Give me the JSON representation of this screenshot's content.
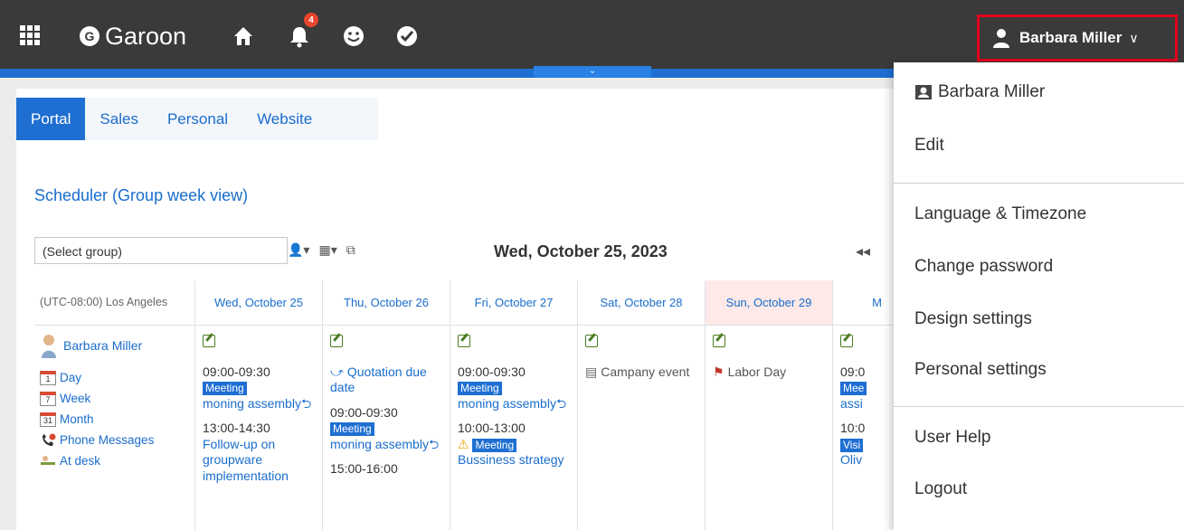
{
  "header": {
    "app_name": "Garoon",
    "logo_letter": "G",
    "notification_count": "4",
    "icons": [
      "app-grid-icon",
      "home-icon",
      "bell-icon",
      "smile-icon",
      "check-icon"
    ],
    "user_name": "Barbara Miller",
    "user_chevron": "∨",
    "collapse_glyph": "⌄"
  },
  "tabs": [
    {
      "label": "Portal",
      "active": true
    },
    {
      "label": "Sales",
      "active": false
    },
    {
      "label": "Personal",
      "active": false
    },
    {
      "label": "Website",
      "active": false
    }
  ],
  "scheduler": {
    "title": "Scheduler (Group week view)",
    "group_select": "(Select group)",
    "date": "Wed, October 25, 2023",
    "prev_glyph": "◂◂",
    "timezone_label": "(UTC-08:00) Los Angeles",
    "columns": [
      "Wed, October 25",
      "Thu, October 26",
      "Fri, October 27",
      "Sat, October 28",
      "Sun, October 29",
      "M"
    ],
    "user": {
      "name": "Barbara Miller",
      "links": [
        "Day",
        "Week",
        "Month",
        "Phone Messages",
        "At desk"
      ],
      "day_num": "1",
      "week_num": "7",
      "month_num": "31"
    },
    "wed": {
      "e1_time": "09:00-09:30",
      "e1_tag": "Meeting",
      "e1_title": "moning assembly⮌",
      "e2_time": "13:00-14:30",
      "e2_title": "Follow-up on groupware implementation"
    },
    "thu": {
      "e1_title": "⤻ Quotation due date",
      "e2_time": "09:00-09:30",
      "e2_tag": "Meeting",
      "e2_title": "moning assembly⮌",
      "e3_time": "15:00-16:00"
    },
    "fri": {
      "e1_time": "09:00-09:30",
      "e1_tag": "Meeting",
      "e1_title": "moning assembly⮌",
      "e2_time": "10:00-13:00",
      "e2_tag": "Meeting",
      "e2_title": "Bussiness strategy"
    },
    "sat": {
      "e1_title": "Campany event"
    },
    "sun": {
      "e1_title": "Labor Day"
    },
    "mon": {
      "e1_time": "09:0",
      "e1_tag": "Mee",
      "e1_title": "assi",
      "e2_time": "10:0",
      "e2_tag": "Visi",
      "e2_title": "Oliv"
    }
  },
  "menu": {
    "profile": "Barbara Miller",
    "edit": "Edit",
    "language": "Language & Timezone",
    "password": "Change password",
    "design": "Design settings",
    "personal": "Personal settings",
    "help": "User Help",
    "logout": "Logout"
  },
  "colors": {
    "header_bg": "#3a3a3a",
    "accent_blue": "#1f6fd2",
    "highlight_red": "#e1001f",
    "badge_red": "#e8452c"
  }
}
